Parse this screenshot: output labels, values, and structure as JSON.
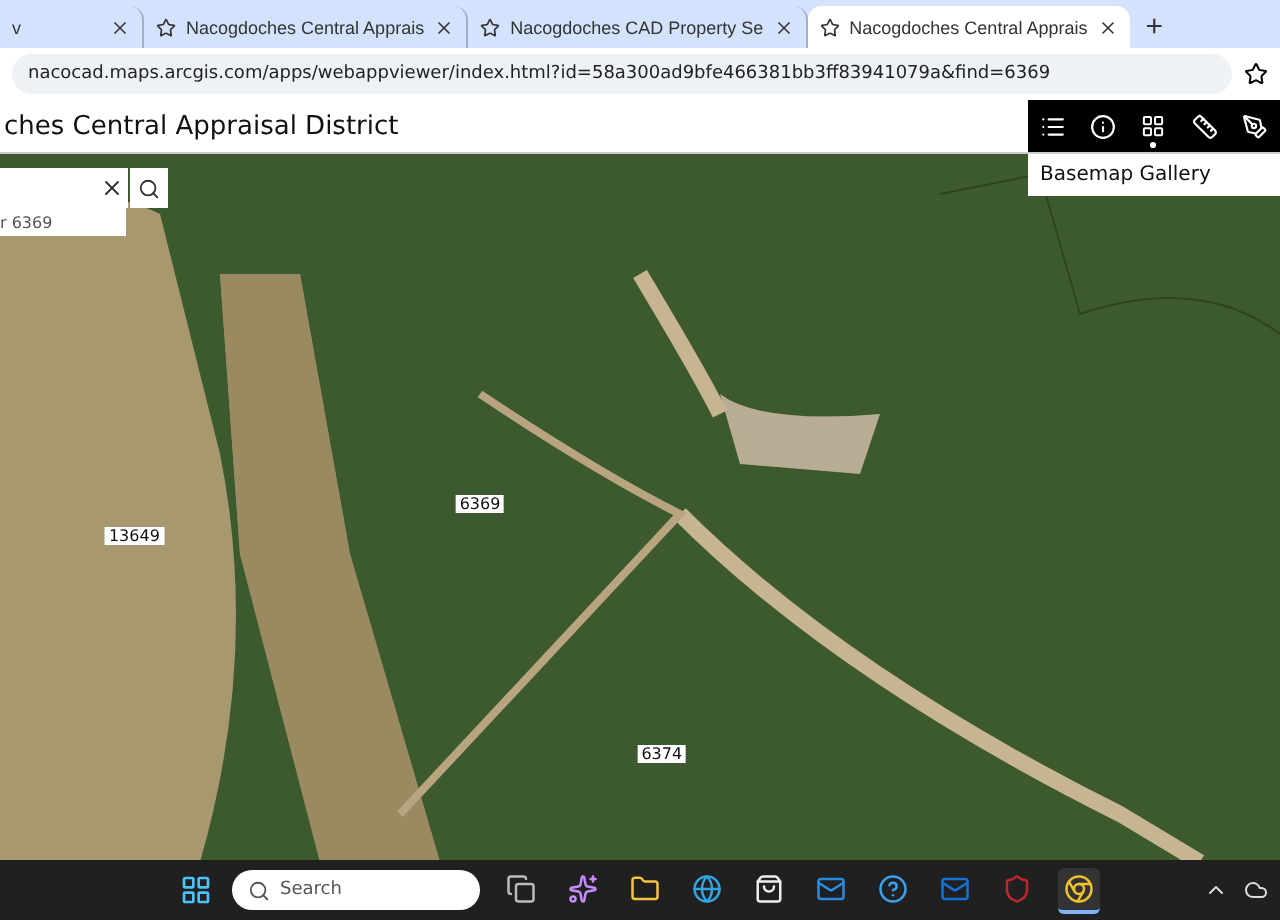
{
  "browser": {
    "tabs": [
      {
        "title": "v",
        "selected": false
      },
      {
        "title": "Nacogdoches Central Apprais",
        "selected": false
      },
      {
        "title": "Nacogdoches CAD Property Se",
        "selected": false
      },
      {
        "title": "Nacogdoches Central Apprais",
        "selected": true
      }
    ],
    "new_tab": "+",
    "url": "nacocad.maps.arcgis.com/apps/webappviewer/index.html?id=58a300ad9bfe466381bb3ff83941079a&find=6369"
  },
  "app": {
    "title": "ches Central Appraisal District",
    "search": {
      "suggestion": "r 6369"
    },
    "tools": [
      {
        "kind": "layers",
        "selected": false
      },
      {
        "kind": "info",
        "selected": false
      },
      {
        "kind": "basemap",
        "selected": true
      },
      {
        "kind": "measure",
        "selected": false
      },
      {
        "kind": "draw",
        "selected": false
      }
    ],
    "panel_title": "Basemap Gallery",
    "parcels": [
      {
        "label": "13649"
      },
      {
        "label": "6369"
      },
      {
        "label": "6374"
      }
    ]
  },
  "taskbar": {
    "search_placeholder": "Search",
    "apps": [
      {
        "kind": "taskview",
        "selected": false
      },
      {
        "kind": "copilot",
        "selected": false
      },
      {
        "kind": "folder",
        "selected": false
      },
      {
        "kind": "edge",
        "selected": false
      },
      {
        "kind": "store",
        "selected": false
      },
      {
        "kind": "mail",
        "selected": false
      },
      {
        "kind": "help",
        "selected": false
      },
      {
        "kind": "outlook",
        "selected": false
      },
      {
        "kind": "shield",
        "selected": false
      },
      {
        "kind": "chrome",
        "selected": true
      }
    ]
  }
}
